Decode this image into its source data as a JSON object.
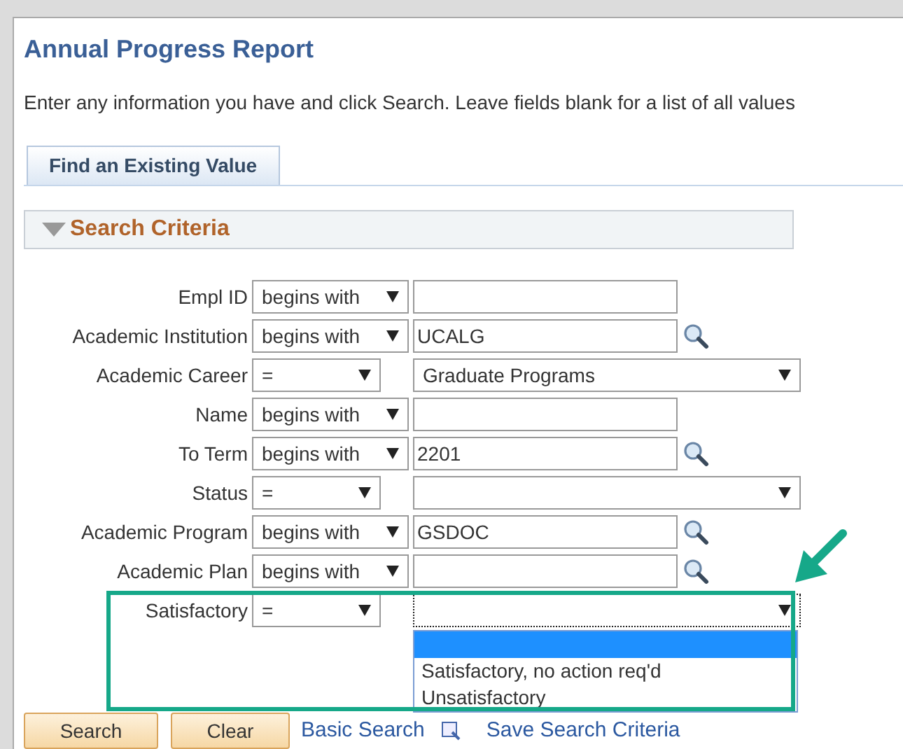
{
  "page": {
    "title": "Annual Progress Report",
    "instructions": "Enter any information you have and click Search. Leave fields blank for a list of all values"
  },
  "tabs": [
    {
      "label": "Find an Existing Value",
      "selected": true
    }
  ],
  "section": {
    "title": "Search Criteria",
    "expanded": true
  },
  "fields": [
    {
      "label": "Empl ID",
      "operator": "begins with",
      "kind": "text",
      "lookup": false
    },
    {
      "label": "Academic Institution",
      "operator": "begins with",
      "kind": "text",
      "value": "UCALG",
      "lookup": true
    },
    {
      "label": "Academic Career",
      "operator": "=",
      "kind": "select",
      "value": "Graduate Programs"
    },
    {
      "label": "Name",
      "operator": "begins with",
      "kind": "text",
      "lookup": false
    },
    {
      "label": "To Term",
      "operator": "begins with",
      "kind": "text",
      "value": "2201",
      "lookup": true
    },
    {
      "label": "Status",
      "operator": "=",
      "kind": "select"
    },
    {
      "label": "Academic Program",
      "operator": "begins with",
      "kind": "text",
      "value": "GSDOC",
      "lookup": true
    },
    {
      "label": "Academic Plan",
      "operator": "begins with",
      "kind": "text",
      "lookup": true
    },
    {
      "label": "Satisfactory",
      "operator": "=",
      "kind": "select",
      "open": true,
      "options": [
        {
          "selected": true
        },
        {
          "label": "Satisfactory, no action req'd",
          "selected": false
        },
        {
          "label": "Unsatisfactory",
          "selected": false
        }
      ]
    }
  ],
  "buttons": [
    "Search",
    "Clear"
  ],
  "links": [
    "Basic Search",
    "Save Search Criteria"
  ]
}
